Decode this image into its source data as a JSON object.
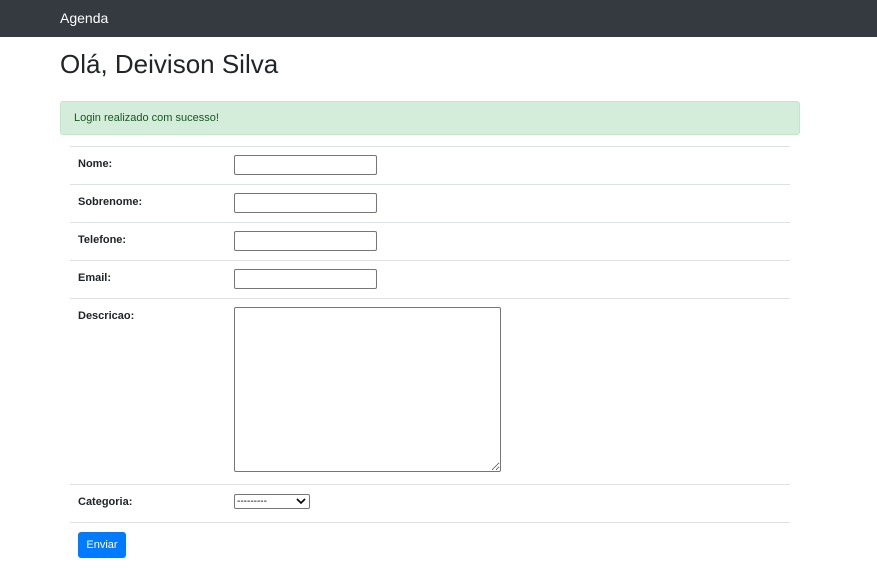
{
  "navbar": {
    "brand": "Agenda"
  },
  "page": {
    "greeting": "Olá, Deivison Silva"
  },
  "alert": {
    "message": "Login realizado com sucesso!",
    "color": "#155724",
    "background": "#d4edda"
  },
  "form": {
    "fields": [
      {
        "label": "Nome:",
        "value": ""
      },
      {
        "label": "Sobrenome:",
        "value": ""
      },
      {
        "label": "Telefone:",
        "value": ""
      },
      {
        "label": "Email:",
        "value": ""
      },
      {
        "label": "Descricao:",
        "value": ""
      },
      {
        "label": "Categoria:",
        "selected": "---------"
      }
    ],
    "submit_label": "Enviar",
    "submit_color": "#007bff"
  }
}
